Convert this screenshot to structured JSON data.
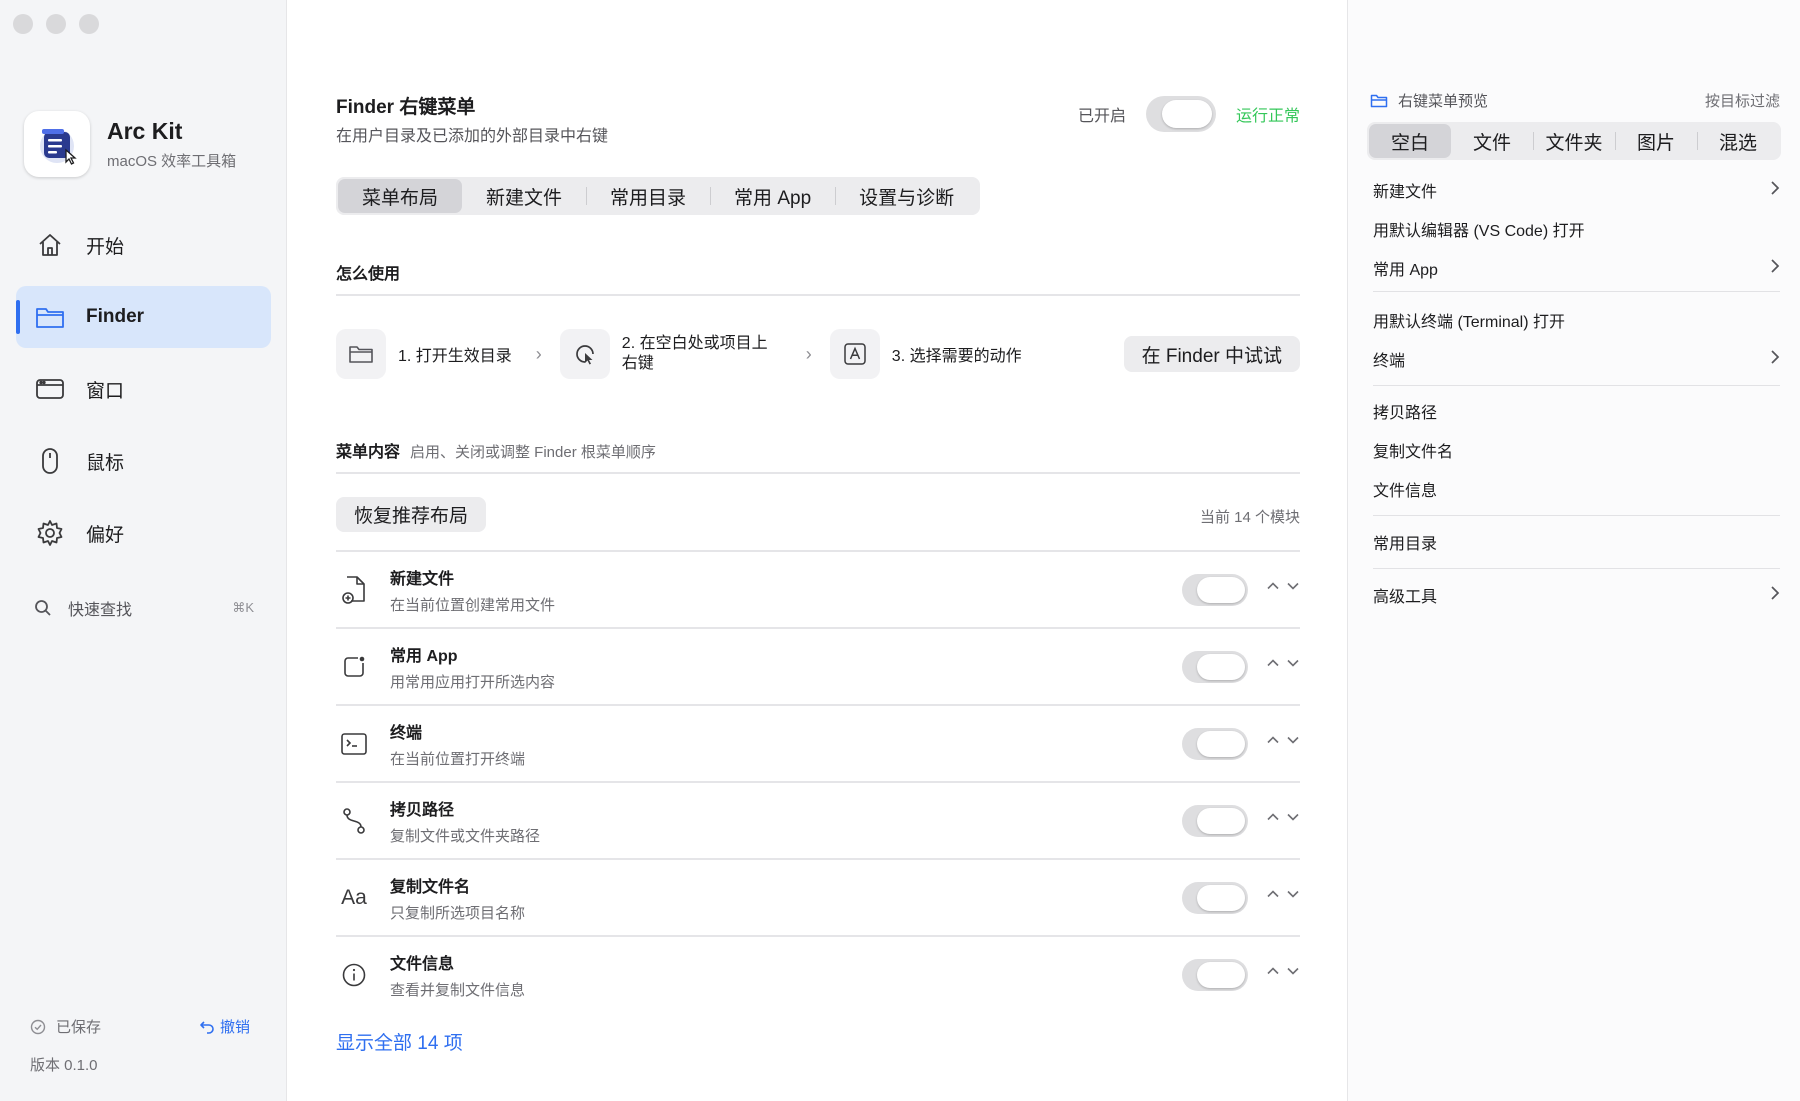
{
  "sidebar": {
    "app_name": "Arc Kit",
    "app_subtitle": "macOS 效率工具箱",
    "nav": [
      {
        "label": "开始",
        "icon": "house-icon"
      },
      {
        "label": "Finder",
        "icon": "folder-icon",
        "active": true
      },
      {
        "label": "窗口",
        "icon": "window-icon"
      },
      {
        "label": "鼠标",
        "icon": "mouse-icon"
      },
      {
        "label": "偏好",
        "icon": "gear-icon"
      }
    ],
    "search_label": "快速查找",
    "search_shortcut": "⌘K",
    "saved_label": "已保存",
    "undo_label": "撤销",
    "version": "版本 0.1.0"
  },
  "main": {
    "title": "Finder 右键菜单",
    "subtitle": "在用户目录及已添加的外部目录中右键",
    "enabled_label": "已开启",
    "status": "运行正常",
    "tabs": [
      "菜单布局",
      "新建文件",
      "常用目录",
      "常用 App",
      "设置与诊断"
    ],
    "active_tab": "菜单布局",
    "how_to_title": "怎么使用",
    "steps": [
      {
        "label": "1. 打开生效目录",
        "icon": "folder-icon"
      },
      {
        "label": "2. 在空白处或项目上右键",
        "icon": "pointer-click-icon"
      },
      {
        "label": "3. 选择需要的动作",
        "icon": "action-letter-icon"
      }
    ],
    "try_button": "在 Finder 中试试",
    "menu_content_title": "菜单内容",
    "menu_content_desc": "启用、关闭或调整 Finder 根菜单顺序",
    "restore_button": "恢复推荐布局",
    "module_count": "当前 14 个模块",
    "items": [
      {
        "title": "新建文件",
        "desc": "在当前位置创建常用文件",
        "icon": "new-file-icon"
      },
      {
        "title": "常用 App",
        "desc": "用常用应用打开所选内容",
        "icon": "app-icon"
      },
      {
        "title": "终端",
        "desc": "在当前位置打开终端",
        "icon": "terminal-icon"
      },
      {
        "title": "拷贝路径",
        "desc": "复制文件或文件夹路径",
        "icon": "path-icon"
      },
      {
        "title": "复制文件名",
        "desc": "只复制所选项目名称",
        "icon": "text-aa-icon",
        "glyph": "Aa"
      },
      {
        "title": "文件信息",
        "desc": "查看并复制文件信息",
        "icon": "info-icon"
      }
    ],
    "show_all": "显示全部 14 项"
  },
  "preview": {
    "title": "右键菜单预览",
    "filter_label": "按目标过滤",
    "tabs": [
      "空白",
      "文件",
      "文件夹",
      "图片",
      "混选"
    ],
    "active_tab": "空白",
    "items": [
      {
        "label": "新建文件",
        "chevron": true
      },
      {
        "label": "用默认编辑器 (VS Code) 打开",
        "chevron": false
      },
      {
        "label": "常用 App",
        "chevron": true
      },
      {
        "label": "用默认终端 (Terminal) 打开",
        "chevron": false
      },
      {
        "label": "终端",
        "chevron": true
      },
      {
        "label": "拷贝路径",
        "chevron": false
      },
      {
        "label": "复制文件名",
        "chevron": false
      },
      {
        "label": "文件信息",
        "chevron": false
      },
      {
        "label": "常用目录",
        "chevron": false
      },
      {
        "label": "高级工具",
        "chevron": true
      }
    ]
  },
  "colors": {
    "accent": "#2f6ff0",
    "status_ok": "#34c759",
    "active_nav_bg": "#d8e6fb"
  }
}
